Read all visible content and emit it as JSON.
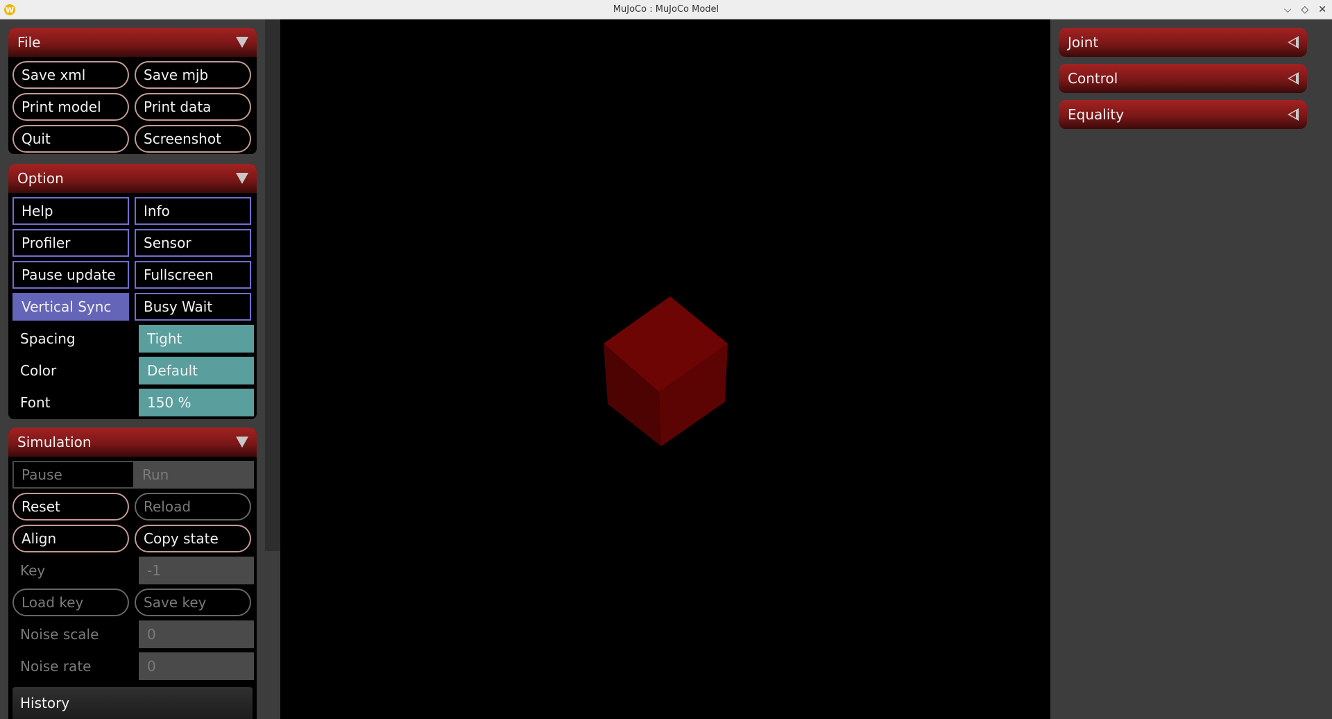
{
  "window": {
    "title": "MuJoCo : MuJoCo Model",
    "app_icon": "W",
    "controls": [
      "chevron-down-icon",
      "restore-icon",
      "close-icon"
    ]
  },
  "left_panel": {
    "file": {
      "title": "File",
      "buttons": [
        "Save xml",
        "Save mjb",
        "Print model",
        "Print data",
        "Quit",
        "Screenshot"
      ]
    },
    "option": {
      "title": "Option",
      "checkboxes": [
        {
          "label": "Help",
          "checked": false
        },
        {
          "label": "Info",
          "checked": false
        },
        {
          "label": "Profiler",
          "checked": false
        },
        {
          "label": "Sensor",
          "checked": false
        },
        {
          "label": "Pause update",
          "checked": false
        },
        {
          "label": "Fullscreen",
          "checked": false
        },
        {
          "label": "Vertical Sync",
          "checked": true
        },
        {
          "label": "Busy Wait",
          "checked": false
        }
      ],
      "selects": [
        {
          "label": "Spacing",
          "value": "Tight"
        },
        {
          "label": "Color",
          "value": "Default"
        },
        {
          "label": "Font",
          "value": "150 %"
        }
      ]
    },
    "simulation": {
      "title": "Simulation",
      "pause_label": "Pause",
      "run_label": "Run",
      "buttons": [
        "Reset",
        "Reload",
        "Align",
        "Copy state",
        "Load key",
        "Save key"
      ],
      "key_label": "Key",
      "key_value": "-1",
      "noise_scale_label": "Noise scale",
      "noise_scale_value": "0",
      "noise_rate_label": "Noise rate",
      "noise_rate_value": "0",
      "history_label": "History"
    }
  },
  "right_panel": {
    "sections": [
      "Joint",
      "Control",
      "Equality"
    ]
  },
  "scene": {
    "object": "cube",
    "color": "#6b0404",
    "background": "#000000"
  },
  "colors": {
    "header_red": "#8a1b1b",
    "checkbox_on": "#6464b8",
    "select_teal": "#5a9e9e",
    "pill_border": "#c49a94"
  }
}
